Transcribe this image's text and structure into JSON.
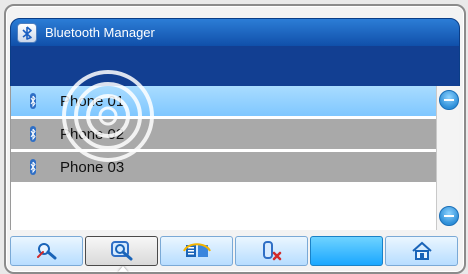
{
  "window": {
    "title": "Bluetooth Manager",
    "accent": "#0f4ea8"
  },
  "devices": [
    {
      "label": "Phone 01",
      "state": "selected"
    },
    {
      "label": "Phone 02",
      "state": "normal"
    },
    {
      "label": "Phone 03",
      "state": "normal"
    }
  ],
  "toolbar": {
    "buttons": [
      {
        "icon": "search-disconnect-icon"
      },
      {
        "icon": "search-icon"
      },
      {
        "icon": "list-paired-icon"
      },
      {
        "icon": "delete-device-icon"
      },
      {
        "icon": ""
      },
      {
        "icon": "home-icon"
      }
    ]
  },
  "colors": {
    "selected_row": "#8fd0ff",
    "normal_row": "#a9a9a9",
    "header_band": "#123f92"
  }
}
